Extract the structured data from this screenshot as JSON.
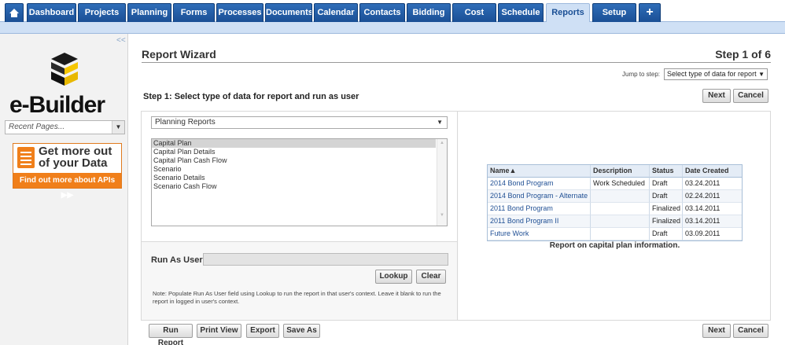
{
  "nav": {
    "tabs": [
      "Dashboard",
      "Projects",
      "Planning",
      "Forms",
      "Processes",
      "Documents",
      "Calendar",
      "Contacts",
      "Bidding",
      "Cost",
      "Schedule",
      "Reports",
      "Setup"
    ],
    "active": "Reports"
  },
  "sidebar": {
    "collapse": "<<",
    "logo": "e-Builder",
    "recent_pages": "Recent Pages...",
    "ad_title": "Get more out of your Data",
    "ad_link": "Find out more about APIs ▶▶"
  },
  "wizard": {
    "title": "Report Wizard",
    "step": "Step 1 of 6",
    "jump_label": "Jump to step:",
    "jump_value": "Select type of data for report",
    "step_heading": "Step 1: Select type of data for report and run as user",
    "next": "Next",
    "cancel": "Cancel",
    "report_category": "Planning Reports",
    "report_types": [
      "Capital Plan",
      "Capital Plan Details",
      "Capital Plan Cash Flow",
      "Scenario",
      "Scenario Details",
      "Scenario Cash Flow"
    ],
    "selected_report": "Capital Plan",
    "run_as_label": "Run As User:",
    "run_as_value": "",
    "lookup": "Lookup",
    "clear": "Clear",
    "note": "Note: Populate Run As User field using Lookup to run the report in that user's context. Leave it blank to run the report in logged in user's context.",
    "preview": {
      "columns": [
        "Name▲",
        "Description",
        "Status",
        "Date Created"
      ],
      "rows": [
        [
          "2014 Bond Program",
          "Work Scheduled",
          "Draft",
          "03.24.2011"
        ],
        [
          "2014 Bond Program - Alternate",
          "",
          "Draft",
          "02.24.2011"
        ],
        [
          "2011 Bond Program",
          "",
          "Finalized",
          "03.14.2011"
        ],
        [
          "2011 Bond Program II",
          "",
          "Finalized",
          "03.14.2011"
        ],
        [
          "Future Work",
          "",
          "Draft",
          "03.09.2011"
        ]
      ],
      "caption": "Report on capital plan information."
    },
    "bottom_buttons": [
      "Run Report",
      "Print View",
      "Export",
      "Save As"
    ]
  }
}
